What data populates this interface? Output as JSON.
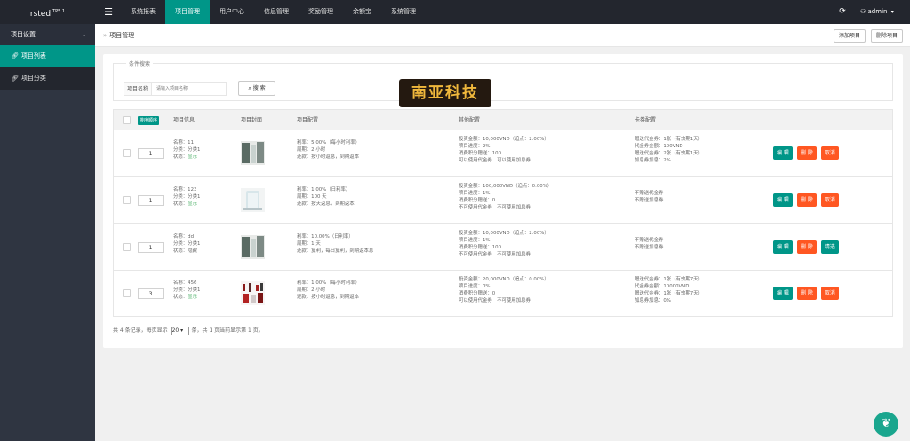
{
  "brand": {
    "name": "rsted",
    "version": "TP5.1"
  },
  "topnav": [
    "系统报表",
    "项目管理",
    "用户中心",
    "信息管理",
    "奖励管理",
    "余额宝",
    "系统管理"
  ],
  "user": {
    "name": "admin"
  },
  "sidebar": {
    "group": "项目设置",
    "items": [
      {
        "label": "项目列表"
      },
      {
        "label": "项目分类"
      }
    ]
  },
  "breadcrumb": "项目管理",
  "toolbar": {
    "add": "添加项目",
    "del": "删除项目"
  },
  "search": {
    "legend": "条件搜索",
    "label": "项目名称",
    "placeholder": "请输入项目名称",
    "button": "搜 索"
  },
  "watermark": "南亚科技",
  "table": {
    "sort_button": "排序顺序",
    "headers": {
      "info": "项目信息",
      "cover": "项目封面",
      "config": "项目配置",
      "other": "其他配置",
      "coupon": "卡券配置"
    },
    "rows": [
      {
        "sort": "1",
        "info": [
          "名称：11",
          "分类：分类1"
        ],
        "status_label": "状态：",
        "status": "显示",
        "config": [
          "利率：5.00%（每小时利率）",
          "周期：2 小时",
          "还款：按小时返息，到期返本"
        ],
        "other": [
          "投资金额：10,000VND（追点：2.00%）",
          "项目进度：2%",
          "消费积分赠送：100",
          "可以使用代金券　可以使用加息券"
        ],
        "coupon": [
          "赠送代金券：1张（有效期1天）",
          "代金券金额：100VND",
          "赠送代金券：2张（有效期1天）",
          "加息券加息：2%"
        ],
        "ops": [
          "编 辑",
          "删 除",
          "取消"
        ]
      },
      {
        "sort": "1",
        "info": [
          "名称：123",
          "分类：分类1"
        ],
        "status_label": "状态：",
        "status": "显示",
        "config": [
          "利率：1.00%（日利率）",
          "周期：100 天",
          "还款：按天返息，到期返本"
        ],
        "other": [
          "投资金额：100,000VND（追点：0.00%）",
          "项目进度：1%",
          "消费积分赠送：0",
          "不可使用代金券　不可使用加息券"
        ],
        "coupon": [
          "不赠送代金券",
          "不赠送加息券"
        ],
        "ops": [
          "编 辑",
          "删 除",
          "取消"
        ]
      },
      {
        "sort": "1",
        "info": [
          "名称：dd",
          "分类：分类1"
        ],
        "status_label": "状态：",
        "status": "隐藏",
        "config": [
          "利率：10.00%（日利率）",
          "周期：1 天",
          "还款：复利，每日复利，到期返本息"
        ],
        "other": [
          "投资金额：10,000VND（追点：2.00%）",
          "项目进度：1%",
          "消费积分赠送：100",
          "不可使用代金券　不可使用加息券"
        ],
        "coupon": [
          "不赠送代金券",
          "不赠送加息券"
        ],
        "ops": [
          "编 辑",
          "删 除",
          "精选"
        ]
      },
      {
        "sort": "3",
        "info": [
          "名称：456",
          "分类：分类1"
        ],
        "status_label": "状态：",
        "status": "显示",
        "config": [
          "利率：1.00%（每小时利率）",
          "周期：2 小时",
          "还款：按小时返息，到期返本"
        ],
        "other": [
          "投资金额：20,000VND（追点：0.00%）",
          "项目进度：0%",
          "消费积分赠送：0",
          "可以使用代金券　不可使用加息券"
        ],
        "coupon": [
          "赠送代金券：1张（有效期7天）",
          "代金券金额：10000VND",
          "赠送代金券：1张（有效期7天）",
          "加息券加息：0%"
        ],
        "ops": [
          "编 辑",
          "删 除",
          "取消"
        ]
      }
    ]
  },
  "pager": {
    "prefix": "共 4 条记录，每页显示",
    "page_size": "20",
    "suffix": "条，共 1 页当前显示第 1 页。"
  },
  "colors": {
    "accent": "#009688",
    "danger": "#ff5722",
    "header": "#23262e",
    "sidebar": "#2f3541"
  },
  "icons": {
    "menu": "hamburger-icon",
    "refresh": "refresh-icon",
    "user": "user-icon",
    "link": "link-icon",
    "search": "search-icon",
    "fab": "leaf-icon"
  }
}
